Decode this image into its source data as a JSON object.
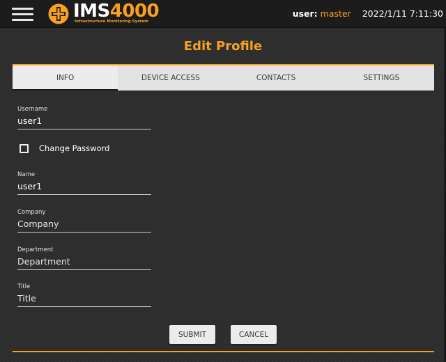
{
  "header": {
    "logo_brand": "IMS",
    "logo_number": "4000",
    "logo_subtitle": "Infrastructure Monitoring System",
    "user_label": "user:",
    "username": "master",
    "datetime": "2022/1/11 7:11:30"
  },
  "page": {
    "title": "Edit Profile"
  },
  "tabs": [
    {
      "label": "INFO",
      "active": true
    },
    {
      "label": "DEVICE ACCESS",
      "active": false
    },
    {
      "label": "CONTACTS",
      "active": false
    },
    {
      "label": "SETTINGS",
      "active": false
    }
  ],
  "form": {
    "username": {
      "label": "Username",
      "value": "user1"
    },
    "change_password": {
      "label": "Change Password",
      "checked": false
    },
    "name": {
      "label": "Name",
      "value": "user1"
    },
    "company": {
      "label": "Company",
      "placeholder": "Company",
      "value": ""
    },
    "department": {
      "label": "Department",
      "placeholder": "Department",
      "value": ""
    },
    "title": {
      "label": "Title",
      "placeholder": "Title",
      "value": ""
    }
  },
  "buttons": {
    "submit": "SUBMIT",
    "cancel": "CANCEL"
  },
  "colors": {
    "accent": "#f7a022",
    "background": "#2b2b2b",
    "topbar": "#1c1c1c",
    "tab_bar": "#e3e3e3"
  },
  "icons": {
    "menu": "hamburger-menu-icon",
    "logo": "ims-cross-logo-icon",
    "checkbox": "checkbox-unchecked-icon"
  }
}
